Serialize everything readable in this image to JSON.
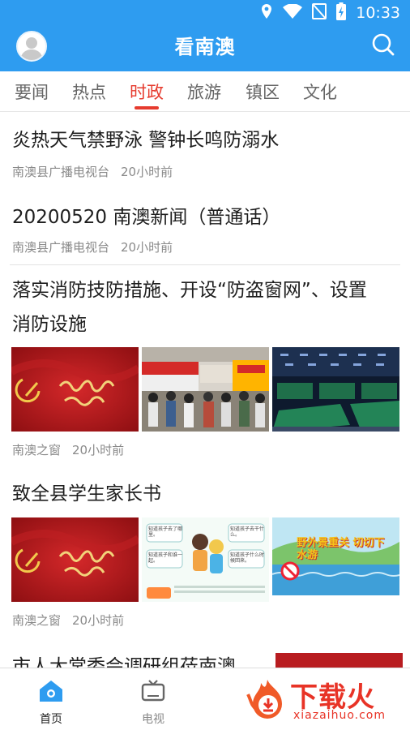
{
  "status_bar": {
    "time": "10:33"
  },
  "header": {
    "title": "看南澳"
  },
  "tabs": [
    {
      "label": "要闻"
    },
    {
      "label": "热点"
    },
    {
      "label": "时政"
    },
    {
      "label": "旅游"
    },
    {
      "label": "镇区"
    },
    {
      "label": "文化"
    }
  ],
  "active_tab": "时政",
  "news": [
    {
      "title": "炎热天气禁野泳 警钟长鸣防溺水",
      "source": "南澳县广播电视台",
      "time": "20小时前"
    },
    {
      "title": "20200520 南澳新闻（普通话）",
      "source": "南澳县广播电视台",
      "time": "20小时前"
    },
    {
      "title_line1": "落实消防技防措施、开设“防盗窗网”、设置",
      "title_line2": "消防设施",
      "source": "南澳之窗",
      "time": "20小时前"
    },
    {
      "title": "致全县学生家长书",
      "source": "南澳之窗",
      "time": "20小时前",
      "thumb2_bubbles": [
        "知道孩子去了哪里。",
        "知道孩子去干什么。",
        "知道孩子和谁一起。",
        "知道孩子什么时候回来。"
      ],
      "thumb3_text": "野外景重关 切切下水游"
    },
    {
      "title": "市人大常委会调研组莅南澳"
    }
  ],
  "bottom_nav": [
    {
      "label": "首页",
      "icon": "home-icon"
    },
    {
      "label": "电视",
      "icon": "tv-icon"
    }
  ],
  "watermark": {
    "text": "下载火",
    "url": "xiazaihuo.com"
  },
  "colors": {
    "primary": "#2e9cf0",
    "accent": "#e63b2e"
  }
}
